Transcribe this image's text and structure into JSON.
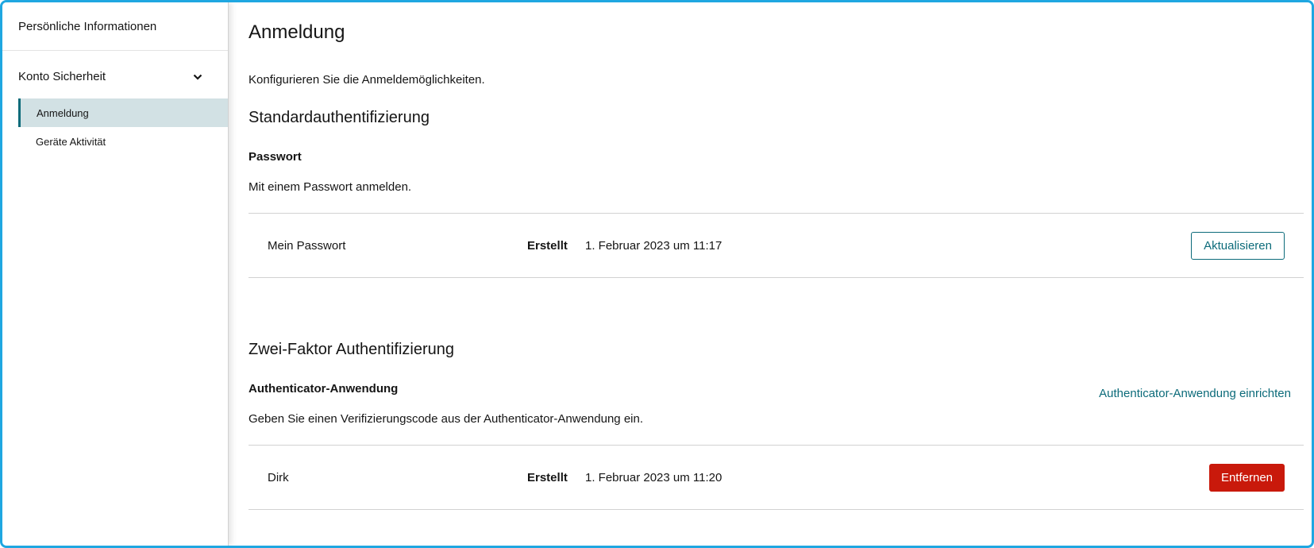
{
  "sidebar": {
    "top_item": "Persönliche Informationen",
    "group_label": "Konto Sicherheit",
    "sub_items": [
      {
        "label": "Anmeldung",
        "active": true
      },
      {
        "label": "Geräte Aktivität",
        "active": false
      }
    ]
  },
  "main": {
    "title": "Anmeldung",
    "description": "Konfigurieren Sie die Anmeldemöglichkeiten.",
    "standard": {
      "heading": "Standardauthentifizierung",
      "password": {
        "title": "Passwort",
        "description": "Mit einem Passwort anmelden.",
        "row": {
          "name": "Mein Passwort",
          "created_label": "Erstellt",
          "created_date": "1. Februar 2023 um 11:17",
          "action_label": "Aktualisieren"
        }
      }
    },
    "two_factor": {
      "heading": "Zwei-Faktor Authentifizierung",
      "authenticator": {
        "title": "Authenticator-Anwendung",
        "setup_link": "Authenticator-Anwendung einrichten",
        "description": "Geben Sie einen Verifizierungscode aus der Authenticator-Anwendung ein.",
        "row": {
          "name": "Dirk",
          "created_label": "Erstellt",
          "created_date": "1. Februar 2023 um 11:20",
          "action_label": "Entfernen"
        }
      }
    }
  },
  "colors": {
    "accent": "#0c6b7a",
    "danger": "#c9190b",
    "active_bg": "#d2e1e4",
    "frame": "#1fa7e1"
  }
}
